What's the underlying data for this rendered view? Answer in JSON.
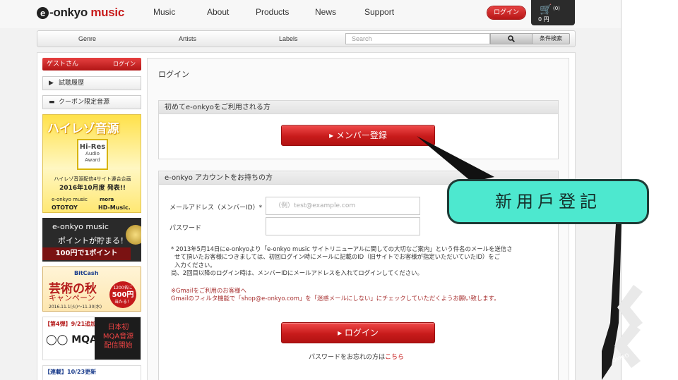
{
  "brand": {
    "logo_e": "e",
    "logo_text": "-onkyo",
    "logo_music": " music"
  },
  "nav": {
    "items": [
      "Music",
      "About",
      "Products",
      "News",
      "Support"
    ],
    "login_label": "ログイン",
    "cart_count": "(0)",
    "cart_total": "0 円"
  },
  "subnav": {
    "genre": "Genre",
    "artists": "Artists",
    "labels": "Labels",
    "search_placeholder": "Search",
    "advanced_label": "条件検索"
  },
  "sidebar": {
    "guest_label": "ゲストさん",
    "guest_login": "ログイン",
    "items": [
      "試聴履歴",
      "クーポン限定音源"
    ],
    "banner_hires": {
      "title": "ハイレゾ音源",
      "award_line1": "Hi-Res",
      "award_line2": "Audio",
      "award_line3": "Award",
      "line1": "ハイレゾ音源配信4サイト連合企画",
      "line2": "2016年10月度 発表!!",
      "brand1": "e-onkyo music",
      "brand2": "mora",
      "brand3": "OTOTOY",
      "brand4": "HD-Music."
    },
    "banner_point": {
      "line1": "e-onkyo music",
      "line2": "ポイントが貯まる！",
      "line3": "100円で1ポイント"
    },
    "banner_art": {
      "brand": "BitCash",
      "line1": "芸術の秋",
      "line2": "キャンペーン",
      "dates": "2016.11.1(火)～11.30(水)",
      "circle_line1": "1200名に",
      "circle_line2": "500円",
      "circle_line3": "当たる！"
    },
    "banner_mqa": {
      "tag": "【第4弾】9/21追加",
      "logo": "◯◯ MQA",
      "box_line1": "日本初",
      "box_line2": "MQA音源",
      "box_line3": "配信開始"
    },
    "banner_news": {
      "tag": "【連載】10/23更新"
    }
  },
  "main": {
    "title": "ログイン",
    "section1_header": "初めてe-onkyoをご利用される方",
    "register_button": "▸ メンバー登録",
    "section2_header": "e-onkyo アカウントをお持ちの方",
    "email_label": "メールアドレス（メンバーID）*",
    "email_placeholder": "（例）test@example.com",
    "password_label": "パスワード",
    "note_line1": "* 2013年5月14日にe-onkyoより「e-onkyo music サイトリニューアルに関しての大切なご案内」という件名のメールを送信さ",
    "note_line2": "せて頂いたお客様につきましては、初回ログイン時にメールに記載のID（旧サイトでお客様が指定いただいていたID）をご",
    "note_line3": "入力ください。",
    "note_line4": "尚、2回目以降のログイン時は、メンバーIDにメールアドレスを入れてログインしてください。",
    "warn_line1": "※Gmailをご利用のお客様へ",
    "warn_line2": "Gmailのフィルタ機能で「shop@e-onkyo.com」を「迷惑メールにしない」にチェックしていただくようお願い致します。",
    "login_button": "▸ ログイン",
    "forgot_text": "パスワードをお忘れの方は",
    "forgot_link": "こちら"
  },
  "callout": {
    "text": "新用戶登記",
    "fill": "#4de8cf",
    "border": "#1e3b36"
  },
  "colors": {
    "accent_red": "#c81e1e",
    "warn_red": "#a83232"
  }
}
